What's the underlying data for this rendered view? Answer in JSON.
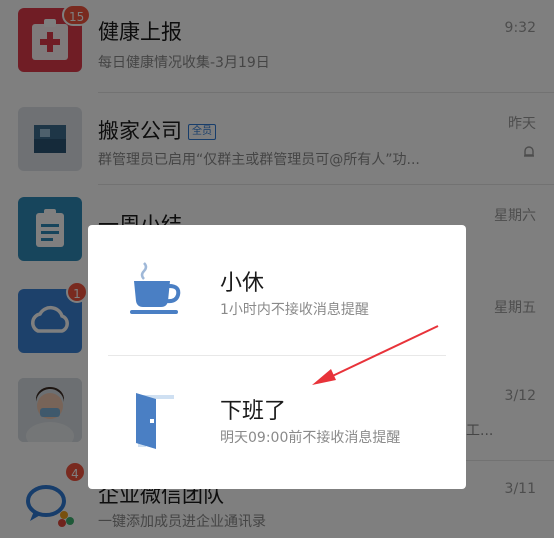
{
  "chats": [
    {
      "title": "健康上报",
      "subtitle": "每日健康情况收集-3月19日",
      "time": "9:32",
      "badge": "15",
      "icon": "health-report-icon"
    },
    {
      "title": "搬家公司",
      "tag": "全员",
      "subtitle": "群管理员已启用“仅群主或群管理员可@所有人”功...",
      "time": "昨天",
      "icon": "group-avatar"
    },
    {
      "title": "一周小结",
      "subtitle": "",
      "time": "星期六",
      "icon": "clipboard-icon"
    },
    {
      "title": "",
      "subtitle": "",
      "time": "星期五",
      "badge": "1",
      "icon": "cloud-icon"
    },
    {
      "title": "",
      "subtitle": "工...",
      "time": "3/12",
      "icon": "person-avatar"
    },
    {
      "title": "企业微信团队",
      "subtitle": "一键添加成员进企业通讯录",
      "time": "3/11",
      "badge": "4",
      "icon": "chat-bubbles-icon"
    }
  ],
  "dialog": {
    "options": [
      {
        "title": "小休",
        "desc": "1小时内不接收消息提醒",
        "icon": "coffee-cup-icon"
      },
      {
        "title": "下班了",
        "desc": "明天09:00前不接收消息提醒",
        "icon": "door-exit-icon"
      }
    ]
  },
  "colors": {
    "accent_blue": "#4a7fc4",
    "badge_red": "#f2543f",
    "annotation_arrow": "#e8333a"
  }
}
